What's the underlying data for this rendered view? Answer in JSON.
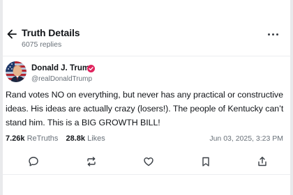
{
  "header": {
    "title": "Truth Details",
    "replies": "6075 replies",
    "back_icon": "arrow-left-icon",
    "more_icon": "more-horizontal-icon"
  },
  "post": {
    "author_name": "Donald J. Trump",
    "author_handle": "@realDonaldTrump",
    "verified_icon": "verified-badge-icon",
    "text": "Rand votes NO on everything, but never has any practical or constructive ideas. His ideas are actually crazy (losers!). The people of Kentucky can’t stand him. This is a BIG GROWTH BILL!",
    "retruths_count": "7.26k",
    "retruths_label": "ReTruths",
    "likes_count": "28.8k",
    "likes_label": "Likes",
    "timestamp": "Jun 03, 2025, 3:23 PM"
  },
  "actions": [
    {
      "name": "reply",
      "icon": "comment-icon"
    },
    {
      "name": "retruth",
      "icon": "retruth-icon"
    },
    {
      "name": "like",
      "icon": "heart-icon"
    },
    {
      "name": "bookmark",
      "icon": "bookmark-icon"
    },
    {
      "name": "share",
      "icon": "share-icon"
    }
  ],
  "colors": {
    "text_primary": "#111418",
    "text_secondary": "#687078",
    "verified": "#e0245e",
    "divider": "#eceef0"
  }
}
